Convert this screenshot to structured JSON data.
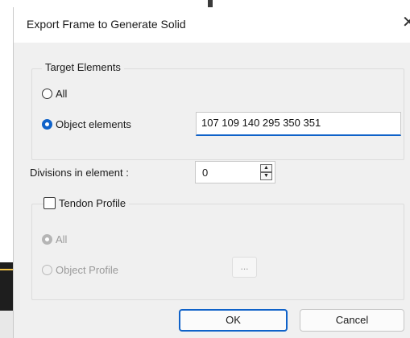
{
  "dialog": {
    "title": "Export Frame to Generate Solid",
    "close_glyph": "✕"
  },
  "target_elements": {
    "legend": "Target Elements",
    "option_all": "All",
    "option_object": "Object elements",
    "selected": "object",
    "object_value": "107 109 140 295 350 351"
  },
  "divisions": {
    "label": "Divisions in element :",
    "value": "0"
  },
  "tendon_profile": {
    "label": "Tendon Profile",
    "checked": false,
    "option_all": "All",
    "option_object": "Object Profile",
    "browse_label": "..."
  },
  "buttons": {
    "ok": "OK",
    "cancel": "Cancel"
  },
  "colors": {
    "accent": "#0f62c9",
    "dialog_bg": "#f0f0f0"
  }
}
